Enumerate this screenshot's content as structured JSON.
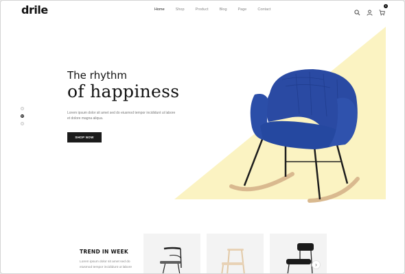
{
  "brand": {
    "logo": "drile"
  },
  "nav": {
    "items": [
      {
        "label": "Home",
        "active": true
      },
      {
        "label": "Shop",
        "active": false
      },
      {
        "label": "Product",
        "active": false
      },
      {
        "label": "Blog",
        "active": false
      },
      {
        "label": "Page",
        "active": false
      },
      {
        "label": "Contact",
        "active": false
      }
    ]
  },
  "header_icons": {
    "search": "search-icon",
    "account": "user-icon",
    "cart": "cart-icon",
    "cart_count": "0"
  },
  "hero": {
    "title_line1": "The rhythm",
    "title_line2": "of happiness",
    "description": "Lorem ipsum dolor sit amet sed do eiusmod tempor incididunt ut labore et dolore magna aliqua.",
    "cta_label": "SHOP NOW",
    "slides": {
      "count": 3,
      "active_index": 1
    },
    "accent_color": "#fbf3c2",
    "chair_color": "#2a4aa3"
  },
  "trend": {
    "title": "TREND IN WEEK",
    "description": "Lorem ipsum dolor sit amet sed do eiusmod tempor incididunt ut labore",
    "next_icon": "chevron-right-icon"
  }
}
